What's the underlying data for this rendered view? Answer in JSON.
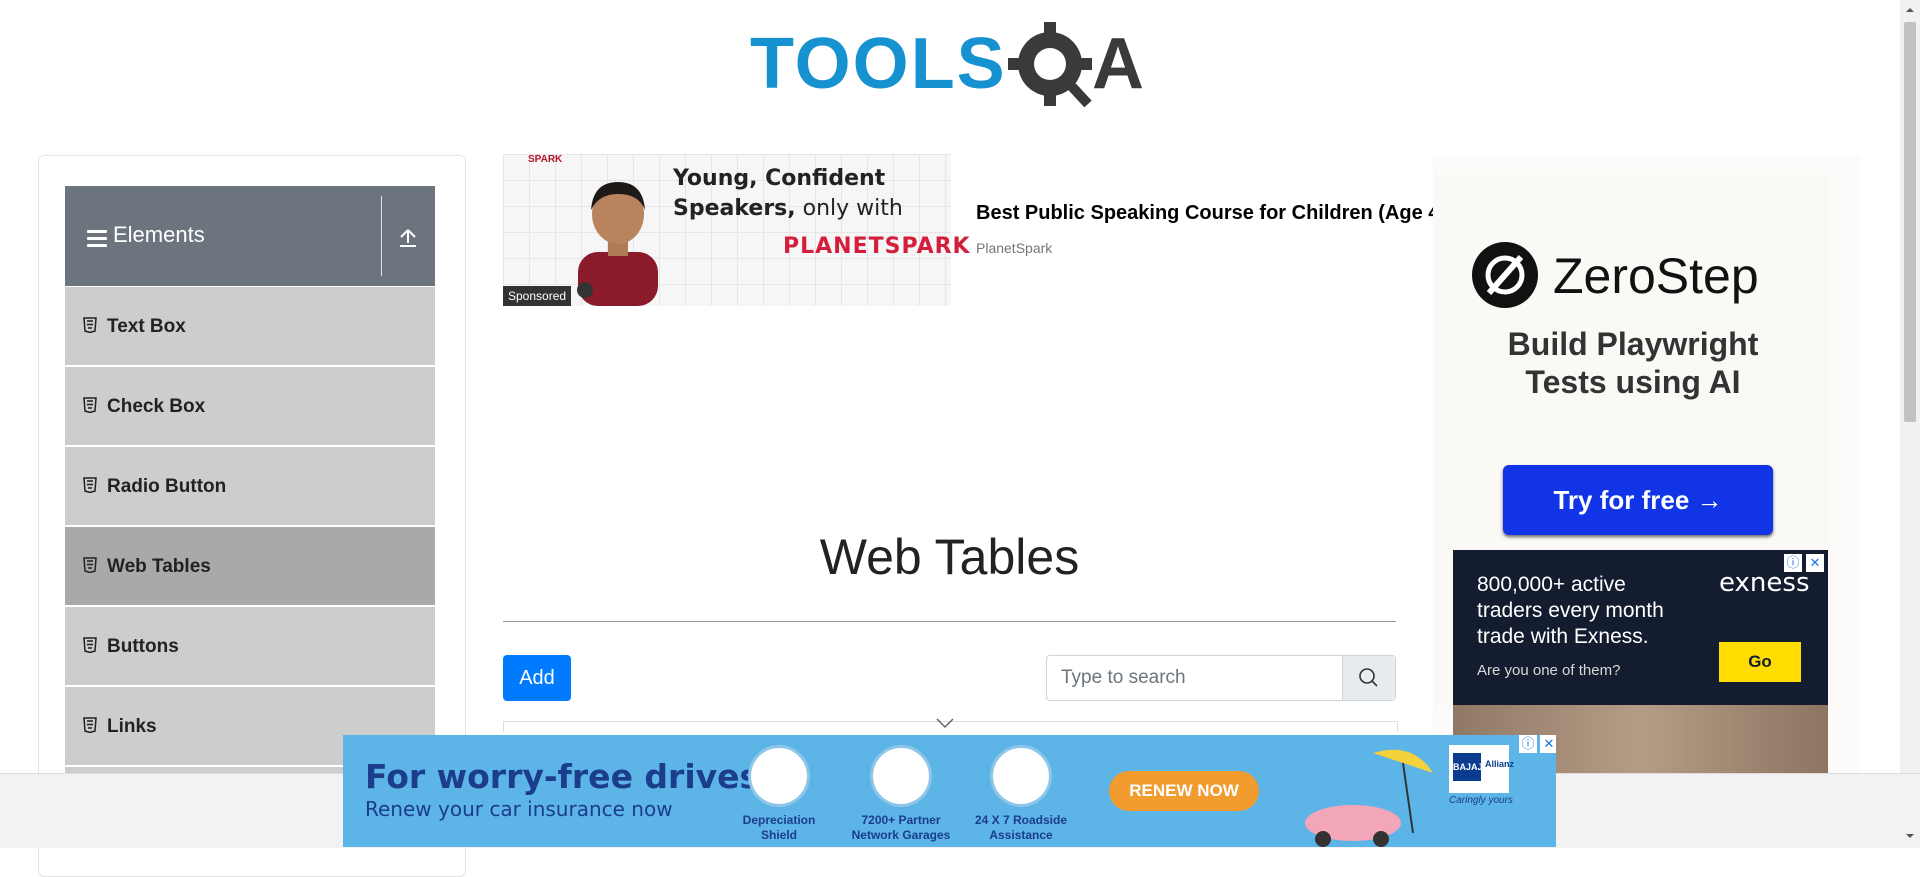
{
  "logo": {
    "text": "TOOLSQA",
    "brand_color": "#1592cf"
  },
  "sidebar": {
    "group": {
      "title": "Elements",
      "icon": "hamburger-icon",
      "collapse_icon": "upload-arrow-icon"
    },
    "items": [
      {
        "label": "Text Box",
        "icon": "html5-icon",
        "active": false
      },
      {
        "label": "Check Box",
        "icon": "html5-icon",
        "active": false
      },
      {
        "label": "Radio Button",
        "icon": "html5-icon",
        "active": false
      },
      {
        "label": "Web Tables",
        "icon": "html5-icon",
        "active": true
      },
      {
        "label": "Buttons",
        "icon": "html5-icon",
        "active": false
      },
      {
        "label": "Links",
        "icon": "html5-icon",
        "active": false
      }
    ]
  },
  "ad_top": {
    "brand_small": "SPARK",
    "slogan_line1": "Young, Confident",
    "slogan_line2_bold": "Speakers,",
    "slogan_line2_rest": "only with",
    "brand": "PLANETSPARK",
    "sponsored": "Sponsored",
    "headline": "Best Public Speaking Course for Children (Age 4",
    "source": "PlanetSpark"
  },
  "main": {
    "title": "Web Tables",
    "add_label": "Add",
    "search_placeholder": "Type to search",
    "accent": "#007bff"
  },
  "ad_right": {
    "zerostep": {
      "name": "ZeroStep",
      "tagline": "Build Playwright Tests using AI",
      "cta": "Try for free →",
      "cta_color": "#1034e6"
    },
    "exness": {
      "text": "800,000+ active traders every month trade with Exness.",
      "brand": "exness",
      "sub": "Are you one of them?",
      "cta": "Go"
    }
  },
  "ad_bottom": {
    "headline": "For worry-free drives,",
    "subline": "Renew your car insurance now",
    "features": [
      {
        "line1": "Depreciation",
        "line2": "Shield"
      },
      {
        "line1": "7200+ Partner",
        "line2": "Network Garages"
      },
      {
        "line1": "24 X 7 Roadside",
        "line2": "Assistance"
      }
    ],
    "cta": "RENEW NOW",
    "brand1": "BAJAJ",
    "brand2": "Allianz",
    "tagline": "Caringly yours"
  }
}
